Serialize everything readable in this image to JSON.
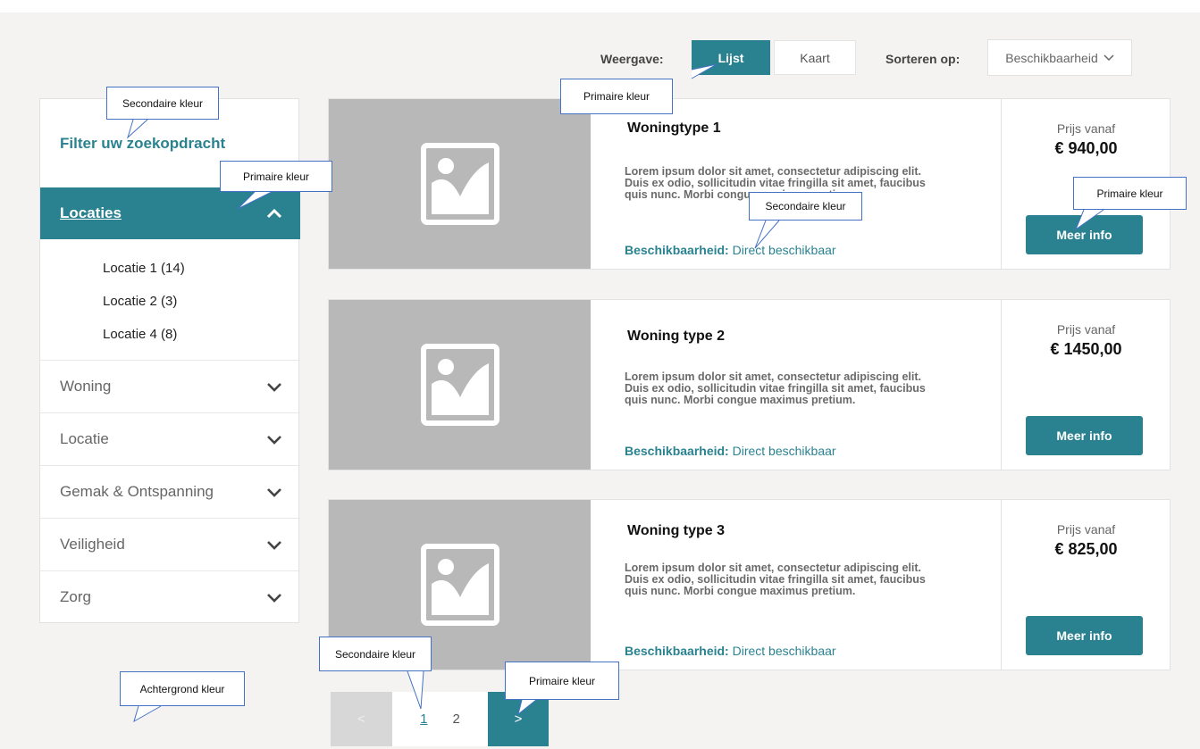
{
  "colors": {
    "primary": "#2a8290",
    "background": "#f5f3f1",
    "placeholder": "#b8b8b8",
    "callout_border": "#4472c4"
  },
  "toolbar": {
    "view_label": "Weergave:",
    "view_list": "Lijst",
    "view_map": "Kaart",
    "sort_label": "Sorteren op:",
    "sort_value": "Beschikbaarheid",
    "sort_icon": "chevron-down-icon"
  },
  "sidebar": {
    "title": "Filter uw zoekopdracht",
    "open_section": {
      "label": "Locaties",
      "icon": "chevron-up-icon",
      "items": [
        "Locatie 1 (14)",
        "Locatie 2 (3)",
        "Locatie 4 (8)"
      ]
    },
    "sections": [
      "Woning",
      "Locatie",
      "Gemak & Ontspanning",
      "Veiligheid",
      "Zorg"
    ]
  },
  "cards": [
    {
      "title": "Woningtype 1",
      "desc": [
        "Lorem ipsum dolor sit amet, consectetur adipiscing elit.",
        "Duis ex odio, sollicitudin vitae fringilla sit amet, faucibus",
        "quis nunc. Morbi congue maximus pretium."
      ],
      "avail_label": "Beschikbaarheid:",
      "avail_value": "Direct beschikbaar",
      "price_label": "Prijs vanaf",
      "price": "€ 940,00",
      "button": "Meer info"
    },
    {
      "title": "Woning type 2",
      "desc": [
        "Lorem ipsum dolor sit amet, consectetur adipiscing elit.",
        "Duis ex odio, sollicitudin vitae fringilla sit amet, faucibus",
        "quis nunc. Morbi congue maximus pretium."
      ],
      "avail_label": "Beschikbaarheid:",
      "avail_value": "Direct beschikbaar",
      "price_label": "Prijs vanaf",
      "price": "€ 1450,00",
      "button": "Meer info"
    },
    {
      "title": "Woning type 3",
      "desc": [
        "Lorem ipsum dolor sit amet, consectetur adipiscing elit.",
        "Duis ex odio, sollicitudin vitae fringilla sit amet, faucibus",
        "quis nunc. Morbi congue maximus pretium."
      ],
      "avail_label": "Beschikbaarheid:",
      "avail_value": "Direct beschikbaar",
      "price_label": "Prijs vanaf",
      "price": "€ 825,00",
      "button": "Meer info"
    }
  ],
  "pagination": {
    "prev": "<",
    "pages": [
      "1",
      "2"
    ],
    "current": "1",
    "next": ">"
  },
  "callouts": {
    "secondary": "Secondaire kleur",
    "primary": "Primaire kleur",
    "background": "Achtergrond kleur"
  }
}
